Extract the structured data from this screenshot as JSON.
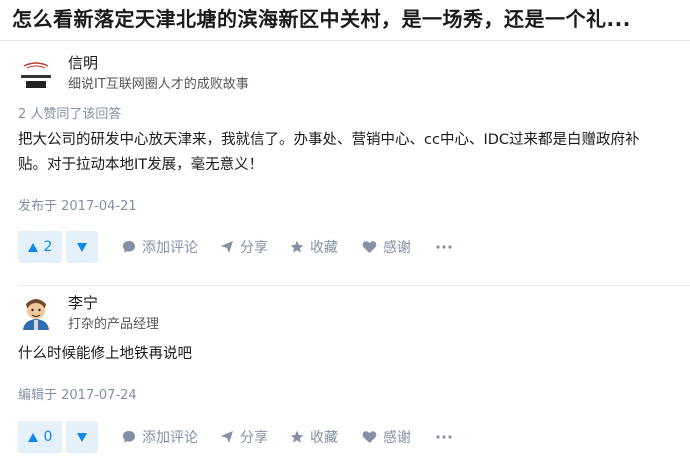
{
  "question": {
    "title": "怎么看新落定天津北塘的滨海新区中关村，是一场秀，还是一个礼..."
  },
  "answers": [
    {
      "author": {
        "name": "信明",
        "bio": "细说IT互联网圈人才的成败故事",
        "avatar_icon": "careerway-logo"
      },
      "vote_summary": "2 人赞同了该回答",
      "body": "把大公司的研发中心放天津来，我就信了。办事处、营销中心、cc中心、IDC过来都是白赠政府补贴。对于拉动本地IT发展，毫无意义！",
      "date": "发布于 2017-04-21",
      "upvotes": "2"
    },
    {
      "author": {
        "name": "李宁",
        "bio": "打杂的产品经理",
        "avatar_icon": "cartoon-avatar"
      },
      "vote_summary": "",
      "body": "什么时候能修上地铁再说吧",
      "date": "编辑于 2017-07-24",
      "upvotes": "0"
    }
  ],
  "actions": {
    "comment": "添加评论",
    "share": "分享",
    "favorite": "收藏",
    "thanks": "感谢",
    "more_icon": "ellipsis-icon"
  },
  "colors": {
    "accent": "#0f88eb",
    "vote_bg": "#e6f0fb",
    "meta_text": "#8590a6",
    "divider": "#ebebeb"
  }
}
